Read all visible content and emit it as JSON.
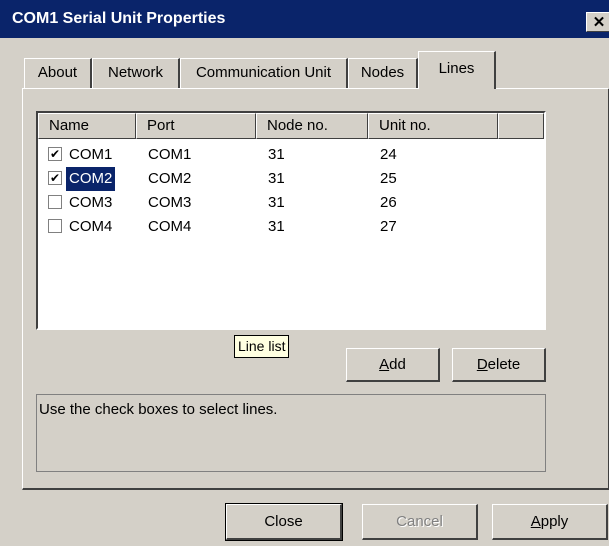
{
  "window": {
    "title": "COM1 Serial Unit Properties",
    "close_glyph": "✕"
  },
  "tabs": [
    {
      "label": "About",
      "active": false
    },
    {
      "label": "Network",
      "active": false
    },
    {
      "label": "Communication Unit",
      "active": false
    },
    {
      "label": "Nodes",
      "active": false
    },
    {
      "label": "Lines",
      "active": true
    }
  ],
  "list": {
    "columns": [
      "Name",
      "Port",
      "Node no.",
      "Unit no."
    ],
    "rows": [
      {
        "checked": true,
        "name": "COM1",
        "port": "COM1",
        "node": "31",
        "unit": "24",
        "selected": false
      },
      {
        "checked": true,
        "name": "COM2",
        "port": "COM2",
        "node": "31",
        "unit": "25",
        "selected": true
      },
      {
        "checked": false,
        "name": "COM3",
        "port": "COM3",
        "node": "31",
        "unit": "26",
        "selected": false
      },
      {
        "checked": false,
        "name": "COM4",
        "port": "COM4",
        "node": "31",
        "unit": "27",
        "selected": false
      }
    ],
    "checkmark": "✔"
  },
  "tooltip": "Line list",
  "buttons": {
    "add_key": "A",
    "add_rest": "dd",
    "delete_key": "D",
    "delete_rest": "elete",
    "close": "Close",
    "cancel": "Cancel",
    "apply_key": "A",
    "apply_rest": "pply"
  },
  "description": "Use the check boxes to select lines.",
  "colors": {
    "title_bar": "#0a246a",
    "face": "#d4d0c8",
    "selection": "#0a246a",
    "tooltip_bg": "#ffffe1"
  }
}
